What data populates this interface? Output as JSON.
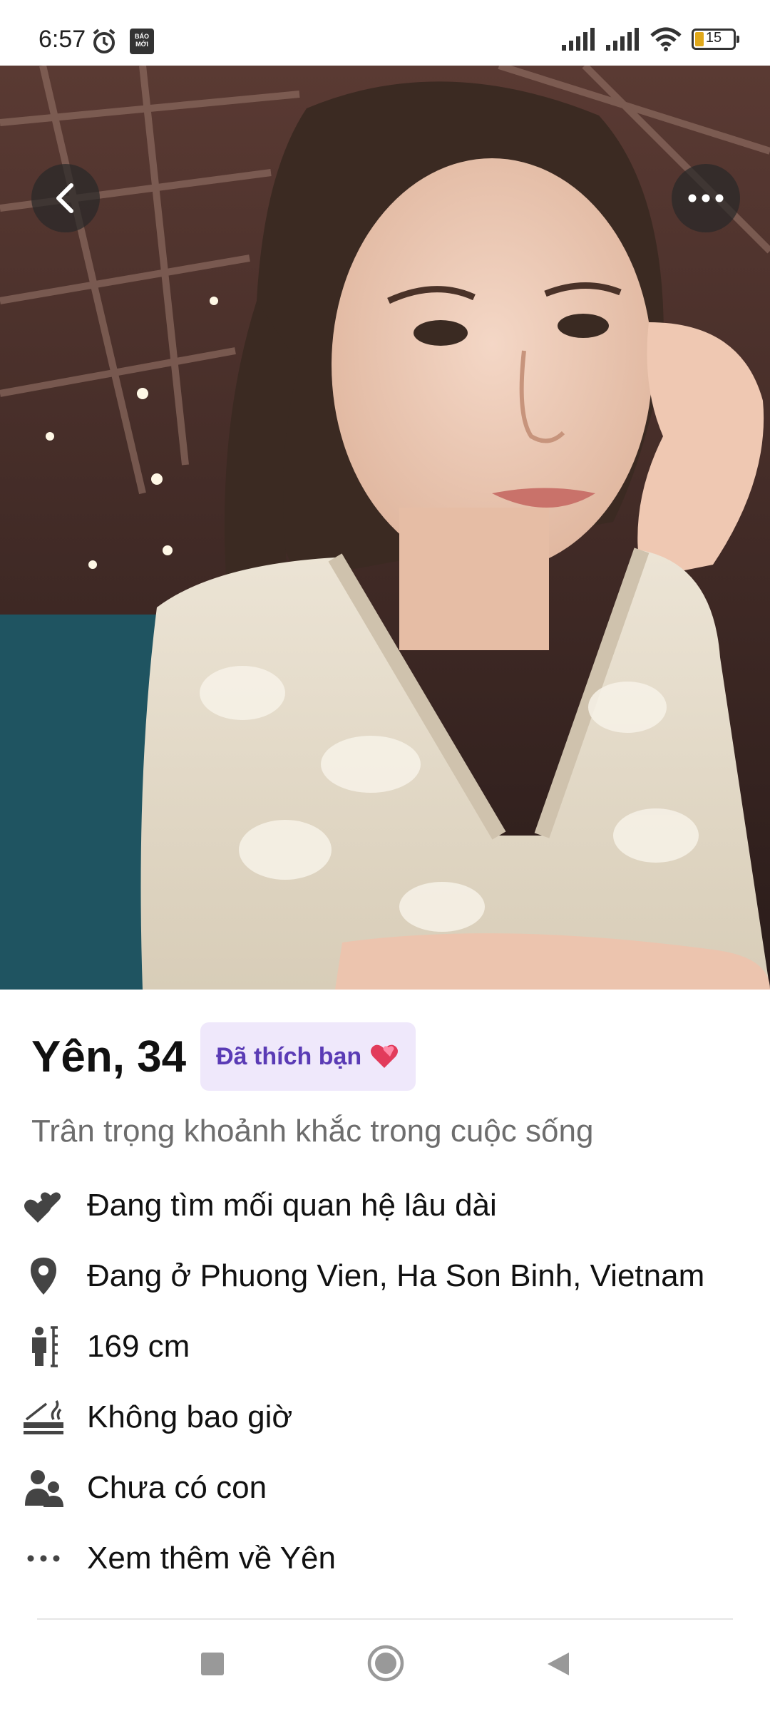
{
  "status_bar": {
    "time": "6:57",
    "news_badge": "BÁO MỚI",
    "battery_level": "15",
    "icons": [
      "alarm-icon",
      "news-app-icon",
      "signal-icon",
      "signal-icon",
      "wifi-icon",
      "battery-icon"
    ]
  },
  "photo": {
    "icons": {
      "back": "chevron-left-icon",
      "more": "more-dots-icon"
    }
  },
  "profile": {
    "name_age": "Yên, 34",
    "liked_badge": "Đã thích bạn",
    "badge_icon": "hearts-icon",
    "bio": "Trân trọng khoảnh khắc trong cuộc sống",
    "details": [
      {
        "icon": "hearts-icon",
        "text": "Đang tìm mối quan hệ lâu dài"
      },
      {
        "icon": "location-pin-icon",
        "text": "Đang ở Phuong Vien, Ha Son Binh, Vietnam"
      },
      {
        "icon": "height-icon",
        "text": "169 cm"
      },
      {
        "icon": "smoking-icon",
        "text": "Không bao giờ"
      },
      {
        "icon": "children-icon",
        "text": "Chưa có con"
      },
      {
        "icon": "more-dots-icon",
        "text": "Xem thêm về Yên"
      }
    ]
  },
  "colors": {
    "accent": "#5a3bb5",
    "badge_bg": "#efe8fb",
    "heart": "#e23b5b"
  },
  "nav_bar": {
    "icons": [
      "recents-icon",
      "home-icon",
      "back-icon"
    ]
  }
}
